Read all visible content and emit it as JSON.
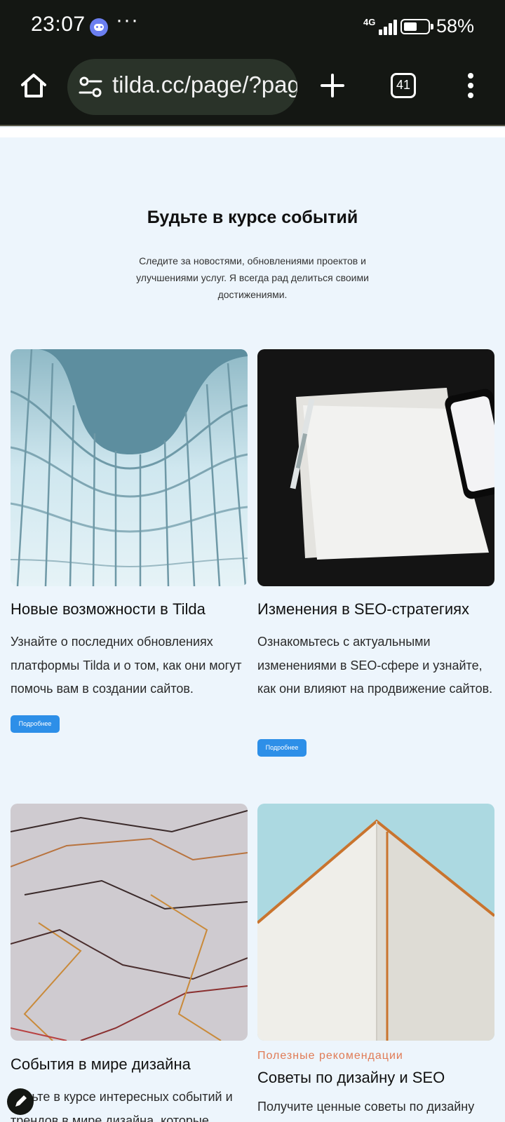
{
  "status_bar": {
    "time": "23:07",
    "more": "···",
    "network": "4G",
    "battery_percent": 58,
    "battery_text": "58%",
    "icons": [
      "discord-icon",
      "signal-icon",
      "battery-icon"
    ]
  },
  "browser": {
    "url": "tilda.cc/page/?page",
    "tab_count": "41",
    "icons": [
      "home-icon",
      "site-settings-icon",
      "new-tab-icon",
      "tabs-icon",
      "menu-icon"
    ]
  },
  "section": {
    "title": "Будьте в курсе событий",
    "description": "Следите за новостями, обновлениями проектов и улучшениями услуг. Я всегда рад делиться своими достижениями."
  },
  "cards": [
    {
      "title": "Новые возможности в Tilda",
      "text": "Узнайте о последних обновлениях платформы Tilda и о том, как они могут помочь вам в создании сайтов.",
      "button": "Подробнее"
    },
    {
      "title": "Изменения в SEO-стратегиях",
      "text": "Ознакомьтесь с актуальными изменениями в SEO-сфере и узнайте, как они влияют на продвижение сайтов.",
      "button": "Подробнее"
    },
    {
      "title": "События в мире дизайна",
      "text": "Будьте в курсе интересных событий и трендов в мире дизайна, которые"
    },
    {
      "tag": "Полезные рекомендации",
      "title": "Советы по дизайну и SEO",
      "text": "Получите ценные советы по дизайну"
    }
  ],
  "colors": {
    "status_bg": "#141713",
    "page_bg": "#edf5fc",
    "button": "#2d8fe8",
    "tag": "#e07b56"
  }
}
